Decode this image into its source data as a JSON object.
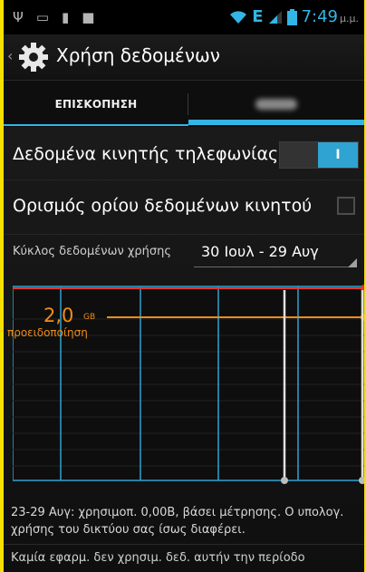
{
  "status_bar": {
    "left_icons": [
      "usb-icon",
      "image-icon",
      "sd-card-icon",
      "flag-icon"
    ],
    "network_type": "E",
    "time": "7:49",
    "am_pm": "μ.μ."
  },
  "action_bar": {
    "title": "Χρήση δεδομένων"
  },
  "tabs": [
    {
      "label": "ΕΠΙΣΚΟΠΗΣΗ",
      "selected": false
    },
    {
      "label": "",
      "selected": true,
      "blurred": true
    }
  ],
  "mobile_data": {
    "label": "Δεδομένα κινητής τηλεφωνίας",
    "toggle_text": "Ι",
    "enabled": true
  },
  "data_limit": {
    "label": "Ορισμός ορίου δεδομένων κινητού",
    "checked": false
  },
  "cycle": {
    "label": "Κύκλος δεδομένων χρήσης",
    "value": "30 Ιουλ - 29 Αυγ"
  },
  "chart_warning": {
    "value": "2,0",
    "unit": "GB",
    "label": "προειδοποίηση"
  },
  "summary": "23-29 Αυγ: χρησιμοπ. 0,00B, βάσει μέτρησης. Ο υπολογ. χρήσης του δικτύου σας ίσως διαφέρει.",
  "no_apps": "Καμία εφαρμ. δεν χρησιμ. δεδ. αυτήν την περίοδο",
  "colors": {
    "accent": "#33b5e5",
    "warning": "#f08c1a",
    "limit": "#e0362e",
    "background": "#000000"
  }
}
